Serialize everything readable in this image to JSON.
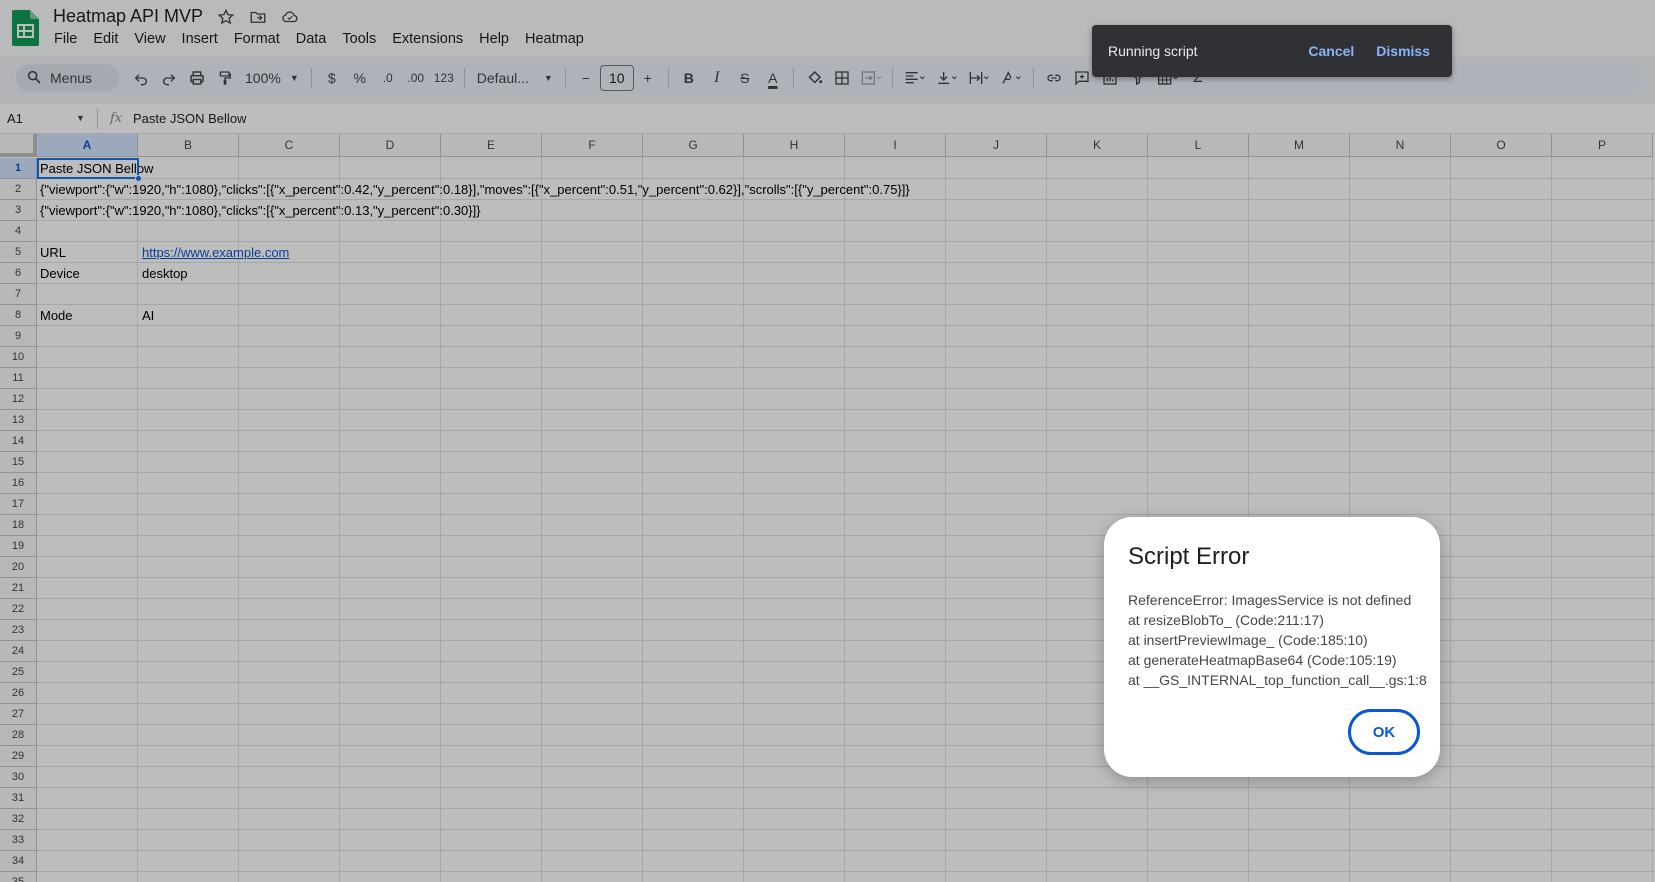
{
  "app": {
    "title": "Heatmap API MVP",
    "menus": [
      "File",
      "Edit",
      "View",
      "Insert",
      "Format",
      "Data",
      "Tools",
      "Extensions",
      "Help",
      "Heatmap"
    ]
  },
  "toolbar": {
    "search_label": "Menus",
    "zoom": "100%",
    "currency": "$",
    "percent": "%",
    "decrease_decimal": ".0",
    "increase_decimal": ".00",
    "number_format": "123",
    "font": "Defaul...",
    "font_size": "10",
    "font_size_minus": "−",
    "font_size_plus": "+",
    "bold": "B",
    "italic": "I",
    "strikethrough": "S",
    "text_color": "A",
    "functions": "Σ"
  },
  "formula_bar": {
    "cell_ref": "A1",
    "fx": "fx",
    "value": "Paste JSON Bellow"
  },
  "columns": [
    "A",
    "B",
    "C",
    "D",
    "E",
    "F",
    "G",
    "H",
    "I",
    "J",
    "K",
    "L",
    "M",
    "N",
    "O",
    "P"
  ],
  "rows": [
    "1",
    "2",
    "3",
    "4",
    "5",
    "6",
    "7",
    "8",
    "9",
    "10",
    "11",
    "12",
    "13",
    "14",
    "15",
    "16",
    "17",
    "18",
    "19",
    "20",
    "21",
    "22",
    "23",
    "24",
    "25",
    "26",
    "27",
    "28",
    "29",
    "30",
    "31",
    "32",
    "33",
    "34",
    "35"
  ],
  "cells": {
    "a1": "Paste JSON Bellow",
    "a2": "{\"viewport\":{\"w\":1920,\"h\":1080},\"clicks\":[{\"x_percent\":0.42,\"y_percent\":0.18}],\"moves\":[{\"x_percent\":0.51,\"y_percent\":0.62}],\"scrolls\":[{\"y_percent\":0.75}]}",
    "a3": "{\"viewport\":{\"w\":1920,\"h\":1080},\"clicks\":[{\"x_percent\":0.13,\"y_percent\":0.30}]}",
    "a5": "URL",
    "b5": "https://www.example.com",
    "a6": "Device",
    "b6": "desktop",
    "a8": "Mode",
    "b8": "AI"
  },
  "snackbar": {
    "text": "Running script",
    "cancel": "Cancel",
    "dismiss": "Dismiss"
  },
  "dialog": {
    "title": "Script Error",
    "lines": [
      "ReferenceError: ImagesService is not defined",
      "at resizeBlobTo_ (Code:211:17)",
      "at insertPreviewImage_ (Code:185:10)",
      "at generateHeatmapBase64 (Code:105:19)",
      "at __GS_INTERNAL_top_function_call__.gs:1:8"
    ],
    "ok": "OK"
  },
  "colors": {
    "accent": "#0b57d0",
    "sheets_green": "#0f9d58",
    "link": "#1155cc",
    "snackbar_bg": "#303134",
    "snackbar_action": "#8ab4f8"
  }
}
